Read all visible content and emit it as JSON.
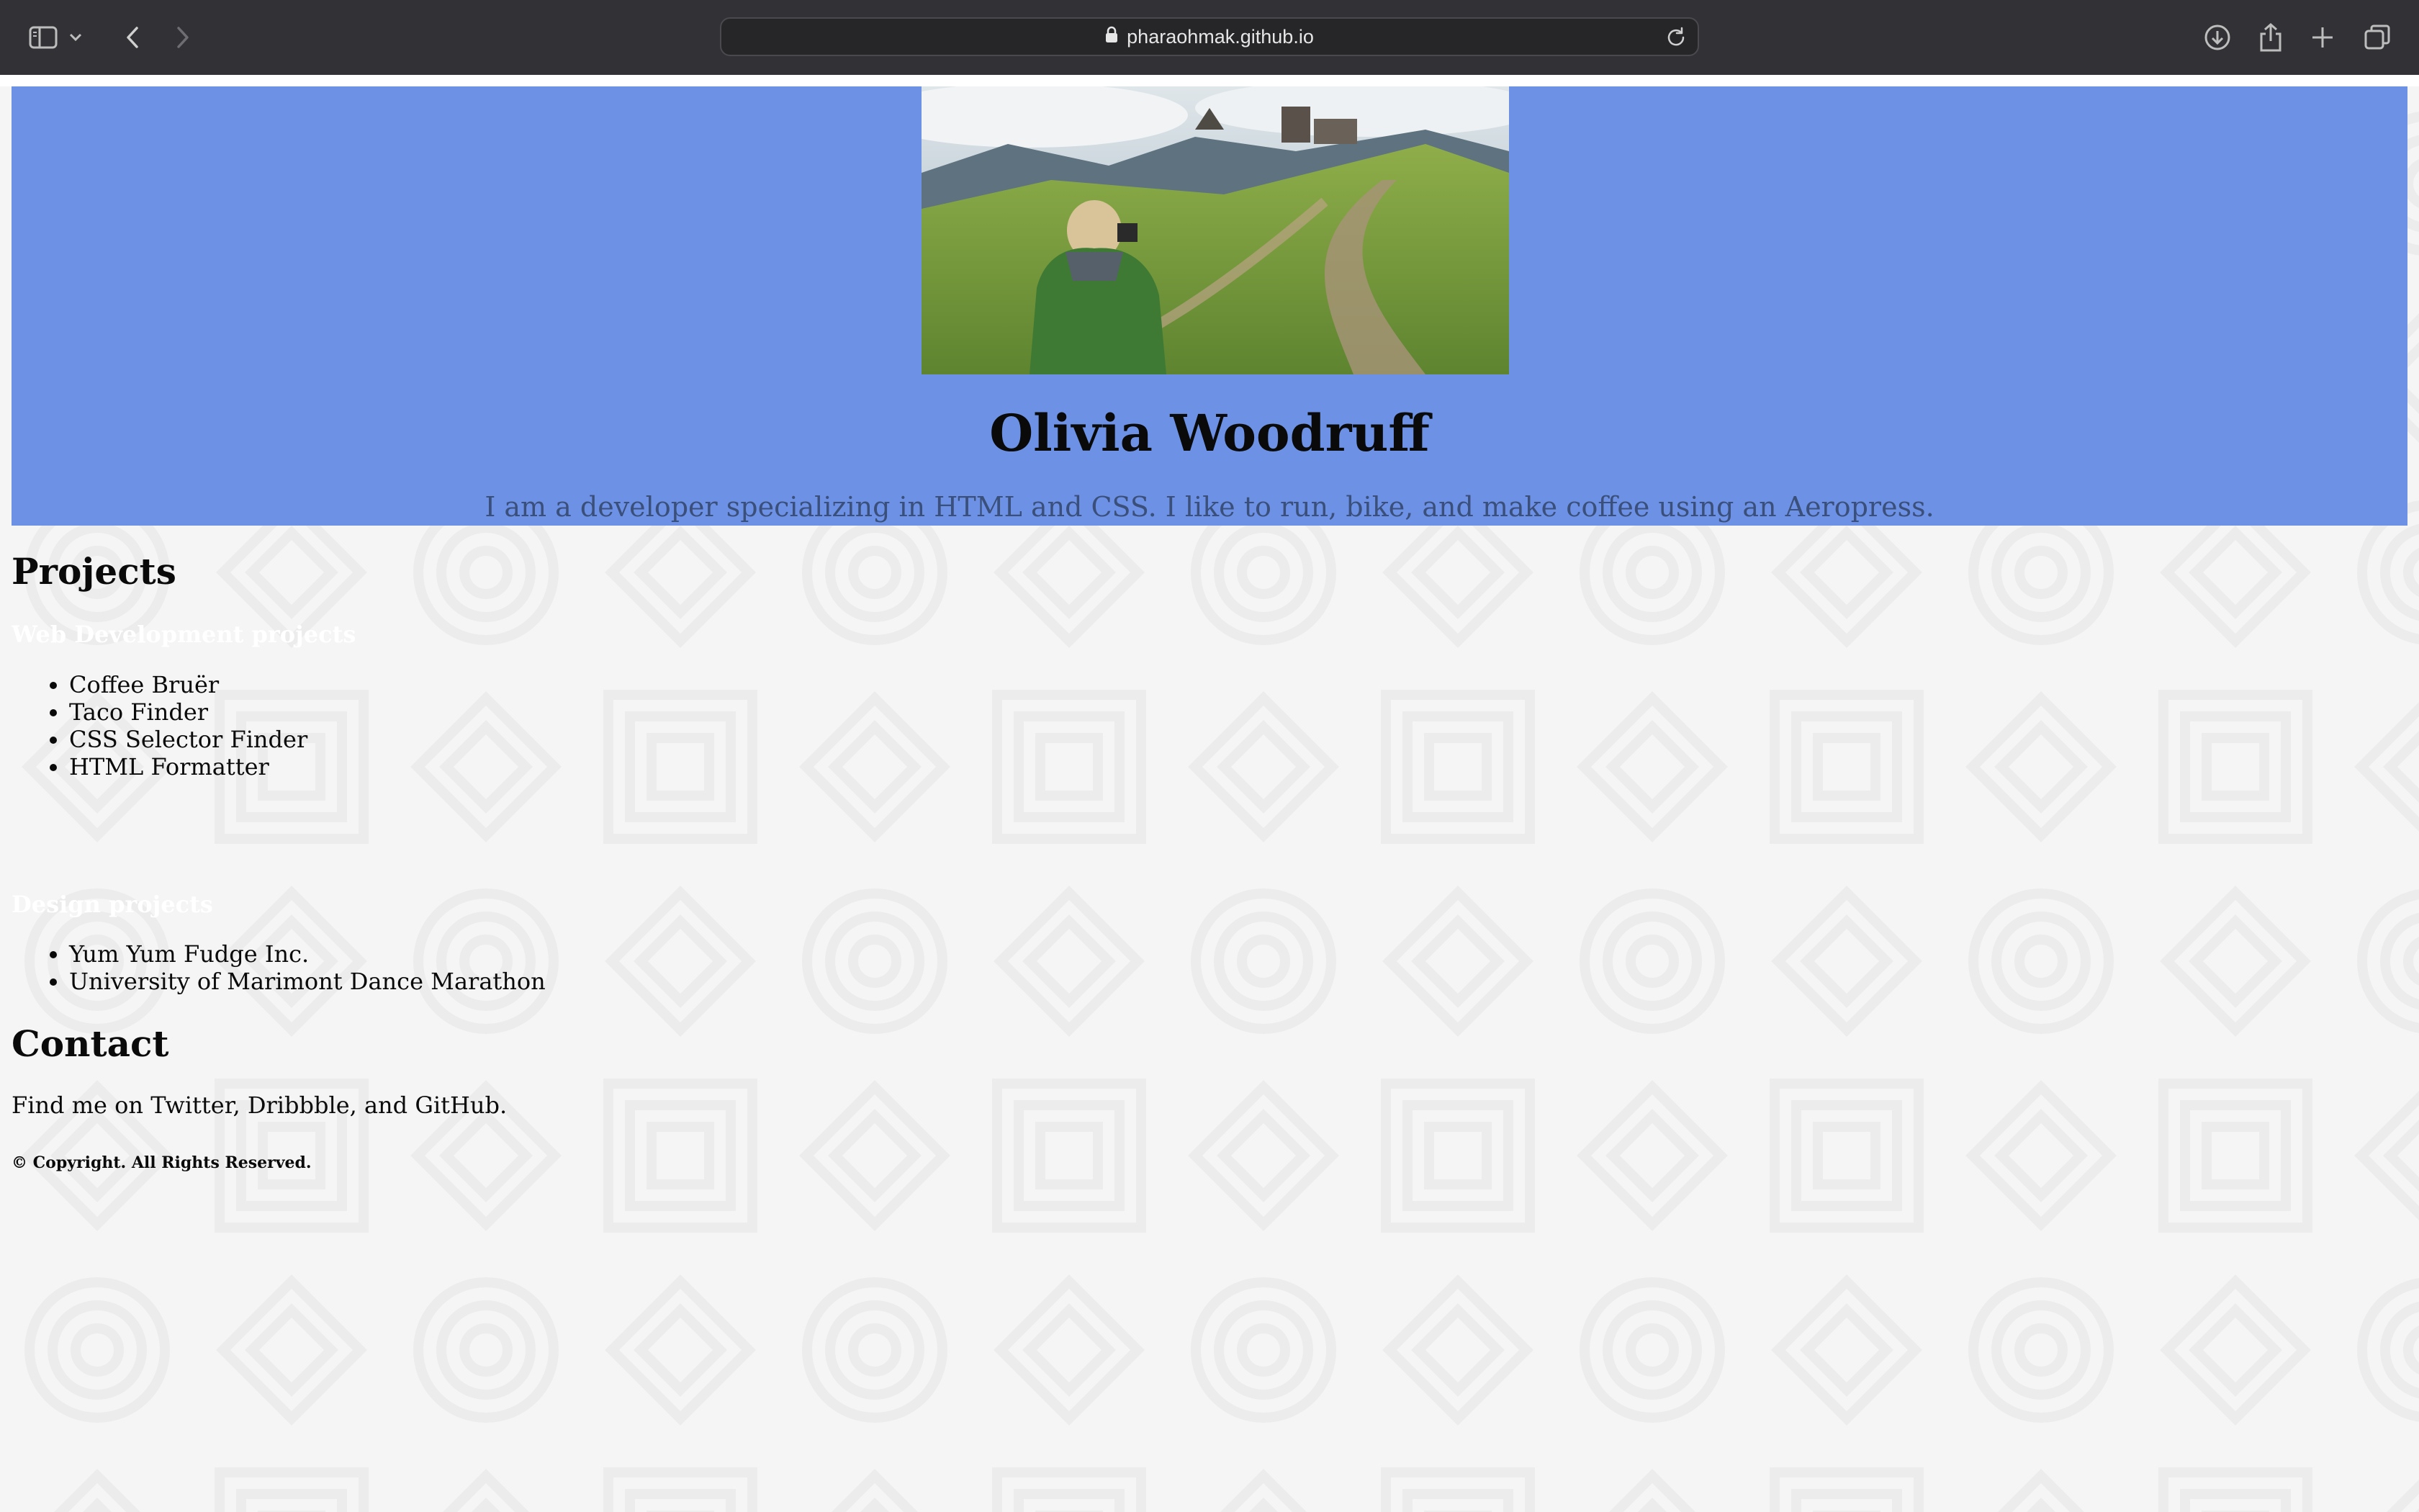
{
  "browser": {
    "url": "pharaohmak.github.io",
    "colors": {
      "toolbar": "#323236",
      "urlbar": "#262629"
    },
    "icons": [
      "sidebar-icon",
      "chevron-down-icon",
      "back-icon",
      "forward-icon",
      "lock-icon",
      "reload-icon",
      "download-icon",
      "share-icon",
      "plus-icon",
      "tabs-overview-icon"
    ]
  },
  "header": {
    "name": "Olivia Woodruff",
    "tagline": "I am a developer specializing in HTML and CSS. I like to run, bike, and make coffee using an Aeropress.",
    "background_color": "#6d92e5"
  },
  "projects": {
    "heading": "Projects",
    "web": {
      "heading": "Web Development projects",
      "items": [
        "Coffee Bruër",
        "Taco Finder",
        "CSS Selector Finder",
        "HTML Formatter"
      ]
    },
    "design": {
      "heading": "Design projects",
      "items": [
        "Yum Yum Fudge Inc.",
        "University of Marimont Dance Marathon"
      ]
    }
  },
  "contact": {
    "heading": "Contact",
    "text": "Find me on Twitter, Dribbble, and GitHub."
  },
  "footer": {
    "copyright": "© Copyright. All Rights Reserved."
  }
}
